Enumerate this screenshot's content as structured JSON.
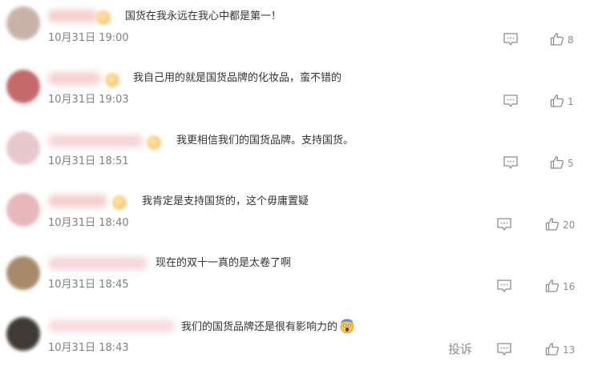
{
  "comments": [
    {
      "text": "国货在我永远在我心中都是第一！",
      "time": "10月31日 19:00",
      "likes": "8",
      "avatar_color": "#c9b3a8"
    },
    {
      "text": "我自己用的就是国货品牌的化妆品，蛮不错的",
      "time": "10月31日 19:03",
      "likes": "1",
      "avatar_color": "#c46a6a"
    },
    {
      "text": "我更相信我们的国货品牌。支持国货。",
      "time": "10月31日 18:51",
      "likes": "5",
      "avatar_color": "#e8c8cc"
    },
    {
      "text": "我肯定是支持国货的，这个毋庸置疑",
      "time": "10月31日 18:40",
      "likes": "20",
      "avatar_color": "#e7b7bb"
    },
    {
      "text": "现在的双十一真的是太卷了啊",
      "time": "10月31日 18:45",
      "likes": "16",
      "avatar_color": "#a78a6a"
    },
    {
      "text": "我们的国货品牌还是很有影响力的",
      "time": "10月31日 18:43",
      "likes": "13",
      "avatar_color": "#3f3a34",
      "emoji": "screaming-face-emoji"
    }
  ],
  "report_label": "投诉",
  "icons": {
    "reply": "comment-bubble-icon",
    "like": "thumbs-up-icon"
  },
  "colors": {
    "text": "#333333",
    "meta": "#808080",
    "icon": "#8c8c8c"
  }
}
